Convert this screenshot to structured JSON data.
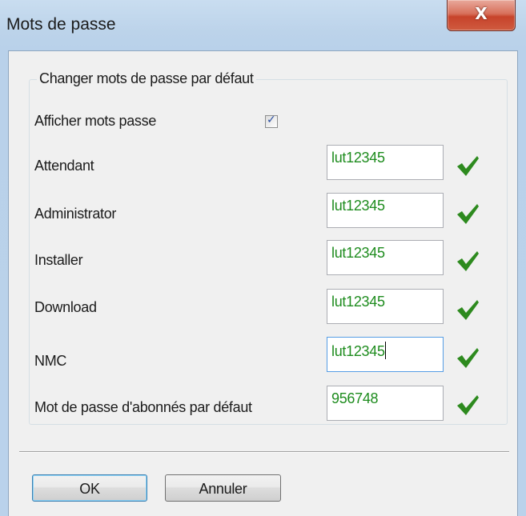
{
  "window": {
    "title": "Mots de passe",
    "close_symbol": "X",
    "close_icon": "close-icon"
  },
  "group": {
    "title": "Changer mots de passe par défaut"
  },
  "show_passwords": {
    "label": "Afficher mots passe",
    "checked": true,
    "check_mark": "✓"
  },
  "fields": [
    {
      "label": "Attendant",
      "value": "lut12345",
      "valid": true
    },
    {
      "label": "Administrator",
      "value": "lut12345",
      "valid": true
    },
    {
      "label": "Installer",
      "value": "lut12345",
      "valid": true
    },
    {
      "label": "Download",
      "value": "lut12345",
      "valid": true
    },
    {
      "label": "NMC",
      "value": "lut12345",
      "valid": true,
      "focused": true
    },
    {
      "label": "Mot de passe d'abonnés par défaut",
      "value": "956748",
      "valid": true
    }
  ],
  "buttons": {
    "ok_label": "OK",
    "cancel_label": "Annuler"
  },
  "colors": {
    "field_text": "#1e8c1e",
    "valid_check": "#2d8a1e",
    "close_button": "#c7432b"
  }
}
